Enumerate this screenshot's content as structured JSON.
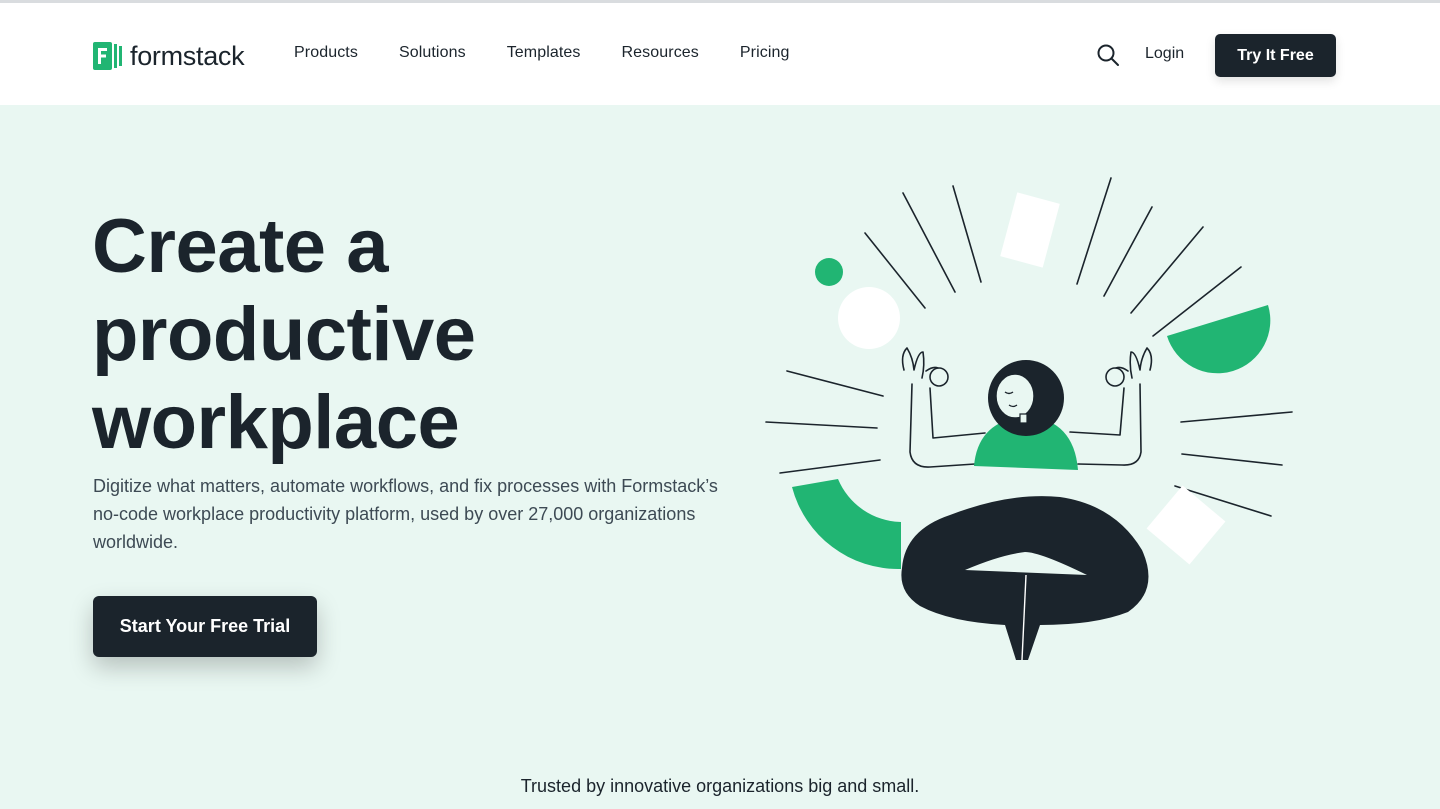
{
  "brand": {
    "name": "formstack",
    "accent_color": "#21b573",
    "dark_color": "#1b242c",
    "hero_bg": "#e9f7f2"
  },
  "nav": {
    "items": [
      {
        "label": "Products"
      },
      {
        "label": "Solutions"
      },
      {
        "label": "Templates"
      },
      {
        "label": "Resources"
      },
      {
        "label": "Pricing"
      }
    ],
    "search_icon": "search-icon",
    "login_label": "Login",
    "try_label": "Try It Free"
  },
  "hero": {
    "title_lines": [
      "Create a",
      "productive",
      "workplace"
    ],
    "description": "Digitize what matters, automate workflows, and fix processes with Formstack’s no-code workplace productivity platform, used by over 27,000 organizations worldwide.",
    "cta_label": "Start Your Free Trial",
    "illustration": "meditating-person-illustration"
  },
  "trusted": {
    "text": "Trusted by innovative organizations big and small."
  }
}
